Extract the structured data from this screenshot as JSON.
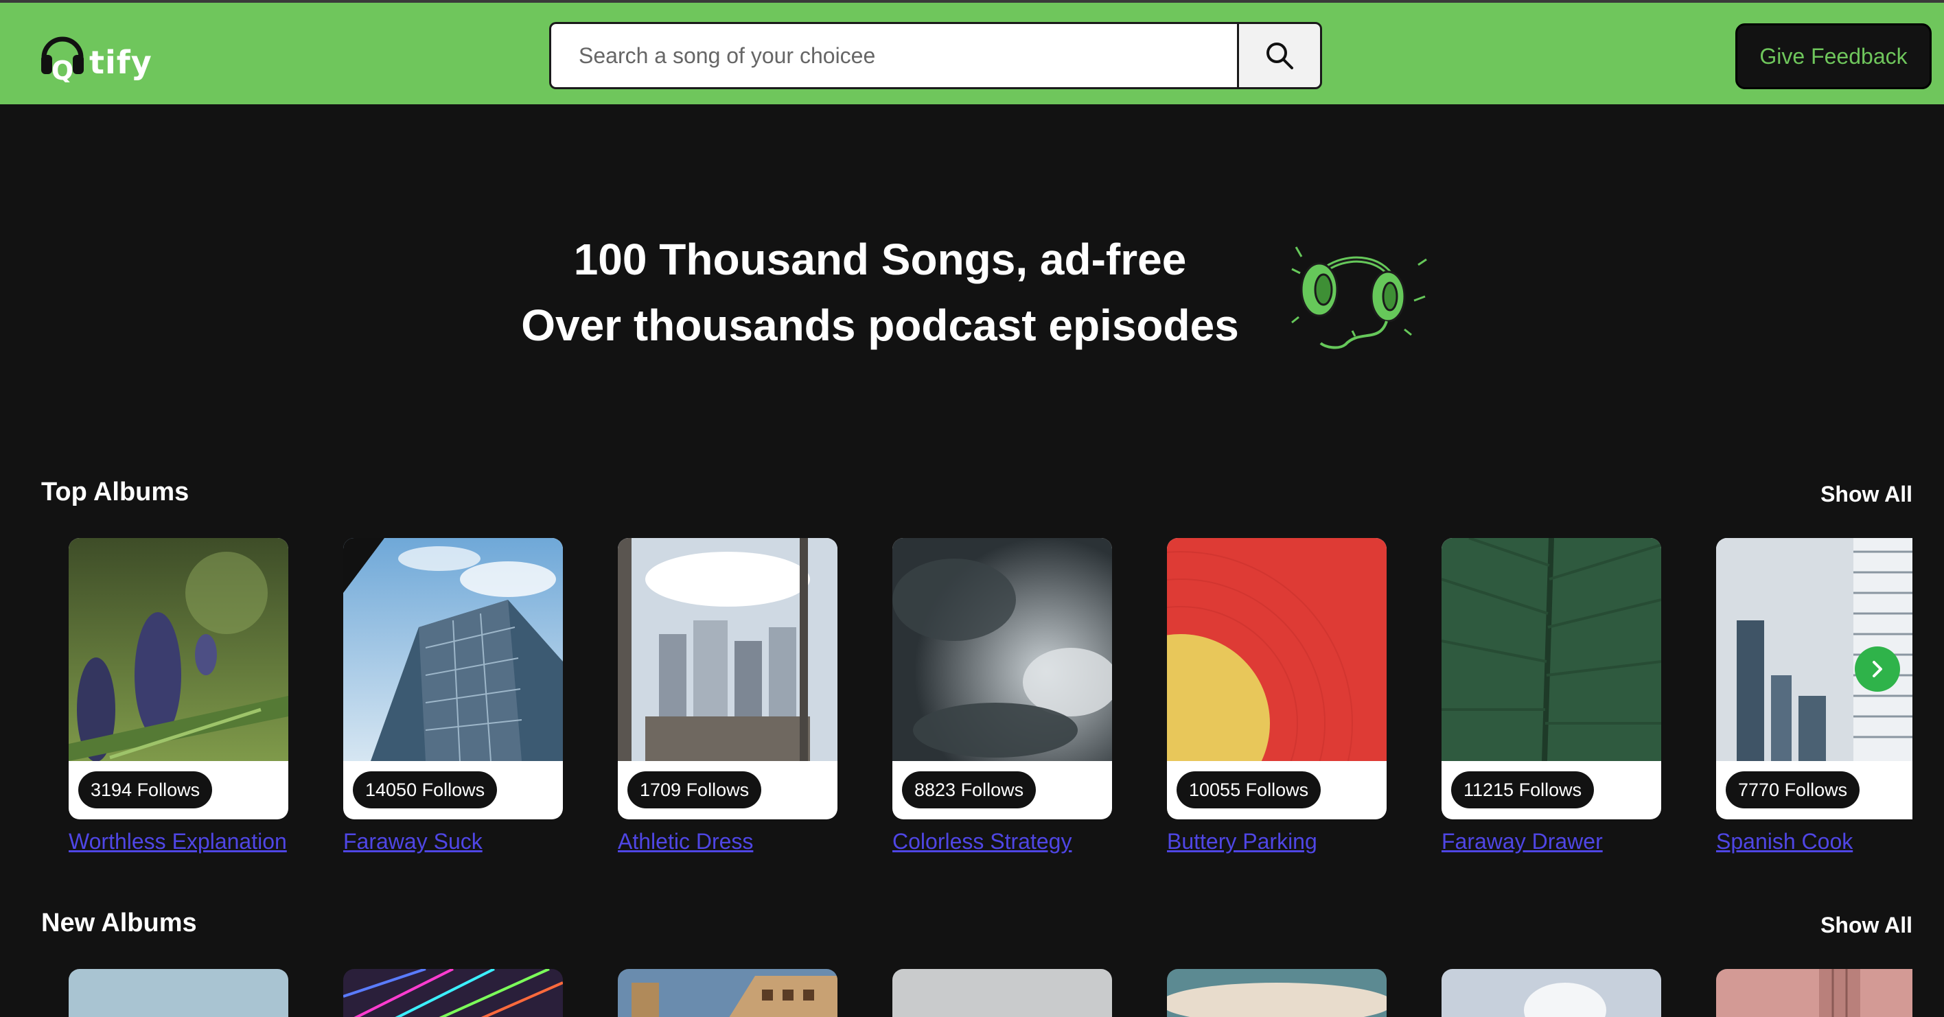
{
  "header": {
    "logo_text": "tify",
    "search_placeholder": "Search a song of your choicee",
    "feedback_label": "Give Feedback"
  },
  "hero": {
    "line1": "100 Thousand Songs, ad-free",
    "line2": "Over thousands podcast episodes"
  },
  "top_albums": {
    "title": "Top Albums",
    "show_all": "Show All",
    "cards": [
      {
        "follows": "3194 Follows",
        "name": "Worthless Explanation"
      },
      {
        "follows": "14050 Follows",
        "name": "Faraway Suck"
      },
      {
        "follows": "1709 Follows",
        "name": "Athletic Dress"
      },
      {
        "follows": "8823 Follows",
        "name": "Colorless Strategy"
      },
      {
        "follows": "10055 Follows",
        "name": "Buttery Parking"
      },
      {
        "follows": "11215 Follows",
        "name": "Faraway Drawer"
      },
      {
        "follows": "7770 Follows",
        "name": "Spanish Cook"
      }
    ]
  },
  "new_albums": {
    "title": "New Albums",
    "show_all": "Show All"
  },
  "colors": {
    "brand_green": "#6fc65c",
    "background": "#121212",
    "link": "#4f46e5"
  },
  "icons": {
    "search": "search-icon",
    "next": "chevron-right-icon",
    "logo": "headphones-icon"
  }
}
